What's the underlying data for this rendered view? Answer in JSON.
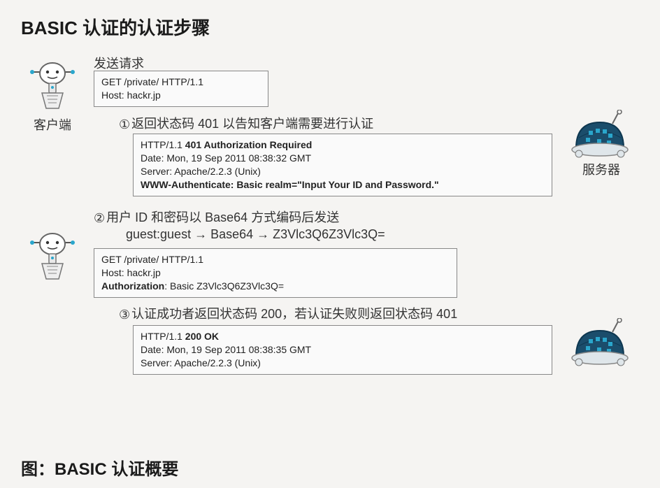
{
  "page_title": "BASIC 认证的认证步骤",
  "figure_caption": "图：BASIC 认证概要",
  "client_label": "客户端",
  "server_label": "服务器",
  "blocks": {
    "req1": {
      "label": "发送请求",
      "line1": "GET /private/ HTTP/1.1",
      "line2": "Host: hackr.jp"
    },
    "step1": {
      "num": "①",
      "label": "返回状态码 401 以告知客户端需要进行认证",
      "l1a": "HTTP/1.1 ",
      "l1b": "401 Authorization Required",
      "l2": "Date: Mon, 19 Sep 2011 08:38:32 GMT",
      "l3": "Server: Apache/2.2.3 (Unix)",
      "l4": "WWW-Authenticate: Basic realm=\"Input Your ID and Password.\""
    },
    "step2": {
      "num": "②",
      "label": "用户 ID 和密码以 Base64 方式编码后发送",
      "sub": "guest:guest → Base64 → Z3Vlc3Q6Z3Vlc3Q=",
      "l1": "GET /private/ HTTP/1.1",
      "l2": "Host: hackr.jp",
      "l3a": "Authorization",
      "l3b": ": Basic Z3Vlc3Q6Z3Vlc3Q="
    },
    "step3": {
      "num": "③",
      "label": "认证成功者返回状态码 200，若认证失败则返回状态码 401",
      "l1a": "HTTP/1.1 ",
      "l1b": "200 OK",
      "l2": "Date: Mon, 19 Sep 2011 08:38:35 GMT",
      "l3": "Server: Apache/2.2.3 (Unix)"
    }
  }
}
